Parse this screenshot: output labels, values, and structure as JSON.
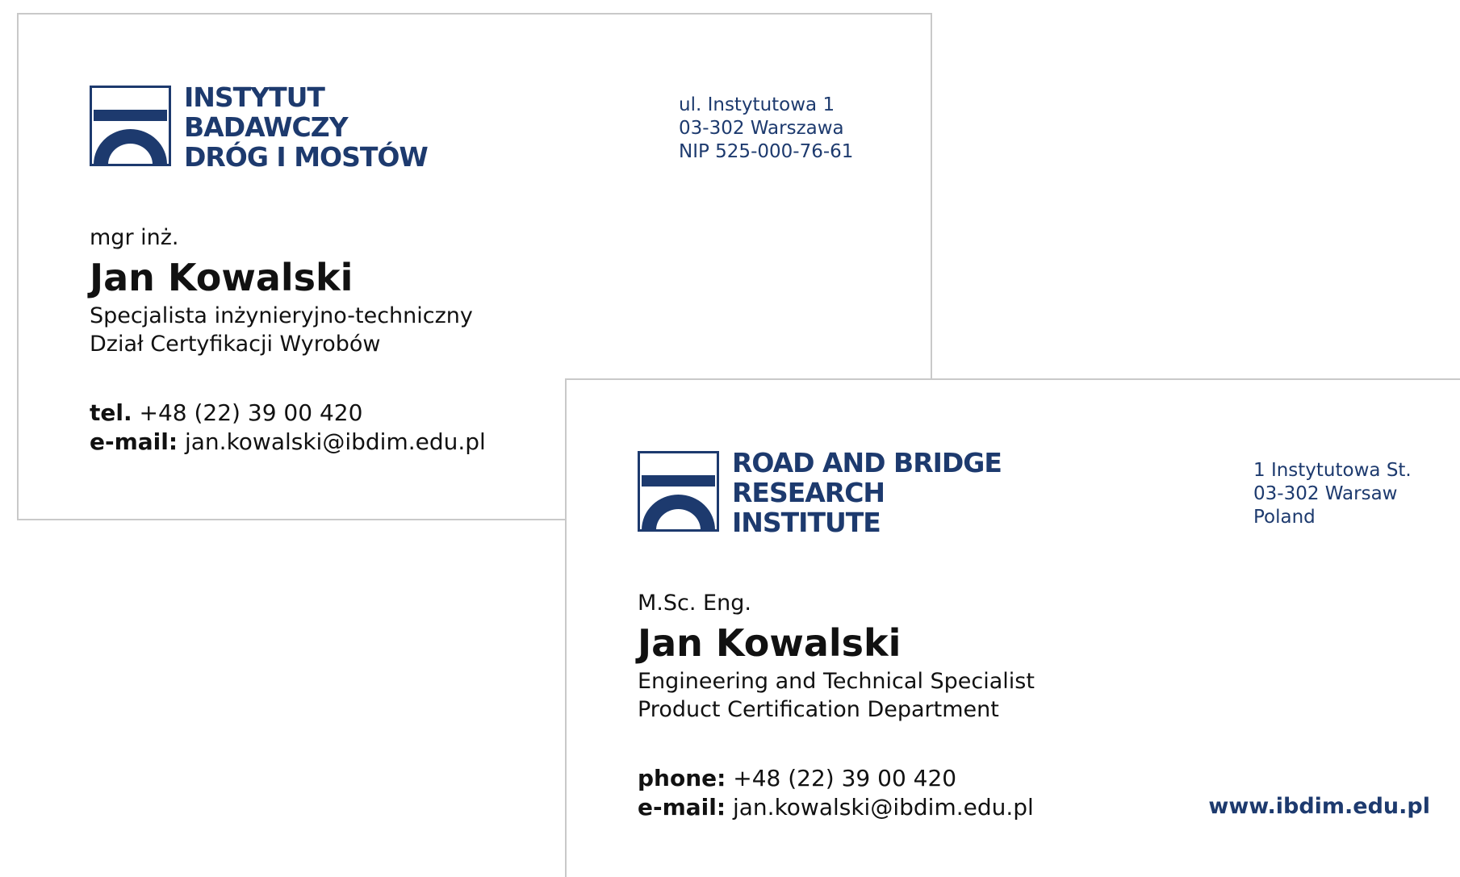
{
  "brand": {
    "color": "#1d3a6e"
  },
  "card_pl": {
    "logo_lines": [
      "INSTYTUT",
      "BADAWCZY",
      "DRÓG I MOSTÓW"
    ],
    "address": [
      "ul. Instytutowa 1",
      "03-302 Warszawa",
      "NIP 525-000-76-61"
    ],
    "degree": "mgr inż.",
    "name": "Jan Kowalski",
    "role": [
      "Specjalista inżynieryjno-techniczny",
      "Dział Certyfikacji Wyrobów"
    ],
    "phone_label": "tel.",
    "phone": "+48 (22) 39 00 420",
    "email_label": "e-mail:",
    "email": "jan.kowalski@ibdim.edu.pl"
  },
  "card_en": {
    "logo_lines": [
      "ROAD AND BRIDGE",
      "RESEARCH",
      "INSTITUTE"
    ],
    "address": [
      "1 Instytutowa St.",
      "03-302 Warsaw",
      "Poland"
    ],
    "degree": "M.Sc. Eng.",
    "name": "Jan Kowalski",
    "role": [
      "Engineering and Technical Specialist",
      "Product Certification Department"
    ],
    "phone_label": "phone:",
    "phone": "+48 (22) 39 00 420",
    "email_label": "e-mail:",
    "email": "jan.kowalski@ibdim.edu.pl",
    "website": "www.ibdim.edu.pl"
  }
}
